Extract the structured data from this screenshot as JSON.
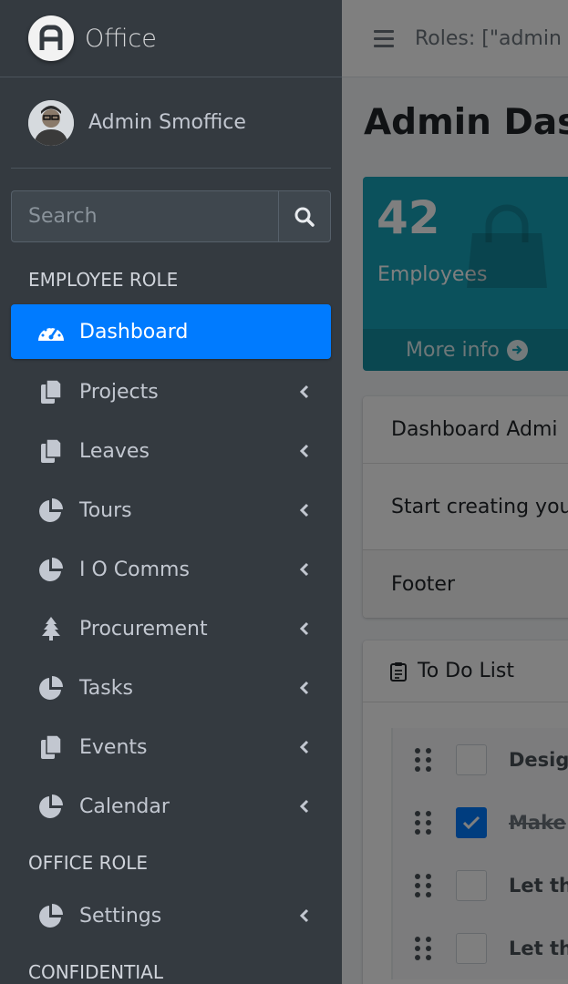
{
  "brand": {
    "name": "Office"
  },
  "user": {
    "name": "Admin Smoffice"
  },
  "search": {
    "placeholder": "Search"
  },
  "sidebar": {
    "headers": [
      "EMPLOYEE ROLE",
      "OFFICE ROLE",
      "CONFIDENTIAL"
    ],
    "items": [
      {
        "label": "Dashboard",
        "icon": "tachometer-icon",
        "active": true
      },
      {
        "label": "Projects",
        "icon": "copy-icon"
      },
      {
        "label": "Leaves",
        "icon": "copy-icon"
      },
      {
        "label": "Tours",
        "icon": "chart-pie-icon"
      },
      {
        "label": "I O Comms",
        "icon": "chart-pie-icon"
      },
      {
        "label": "Procurement",
        "icon": "tree-icon"
      },
      {
        "label": "Tasks",
        "icon": "chart-pie-icon"
      },
      {
        "label": "Events",
        "icon": "copy-icon"
      },
      {
        "label": "Calendar",
        "icon": "chart-pie-icon"
      },
      {
        "label": "Settings",
        "icon": "chart-pie-icon"
      }
    ]
  },
  "topbar": {
    "roles_text": "Roles: [\"admin"
  },
  "page": {
    "title": "Admin Dash"
  },
  "smallbox": {
    "count": "42",
    "label": "Employees",
    "link_text": "More info",
    "color": "#17a2b8"
  },
  "card": {
    "header": "Dashboard Admi",
    "body": "Start creating your",
    "footer": "Footer"
  },
  "todo": {
    "title": "To Do List",
    "items": [
      {
        "text": "Desig",
        "done": false
      },
      {
        "text": "Make",
        "done": true
      },
      {
        "text": "Let th",
        "done": false
      },
      {
        "text": "Let th",
        "done": false
      }
    ]
  },
  "colors": {
    "sidebar_bg": "#343a40",
    "accent": "#007bff",
    "overlay": "rgba(0,0,0,0.5)"
  }
}
